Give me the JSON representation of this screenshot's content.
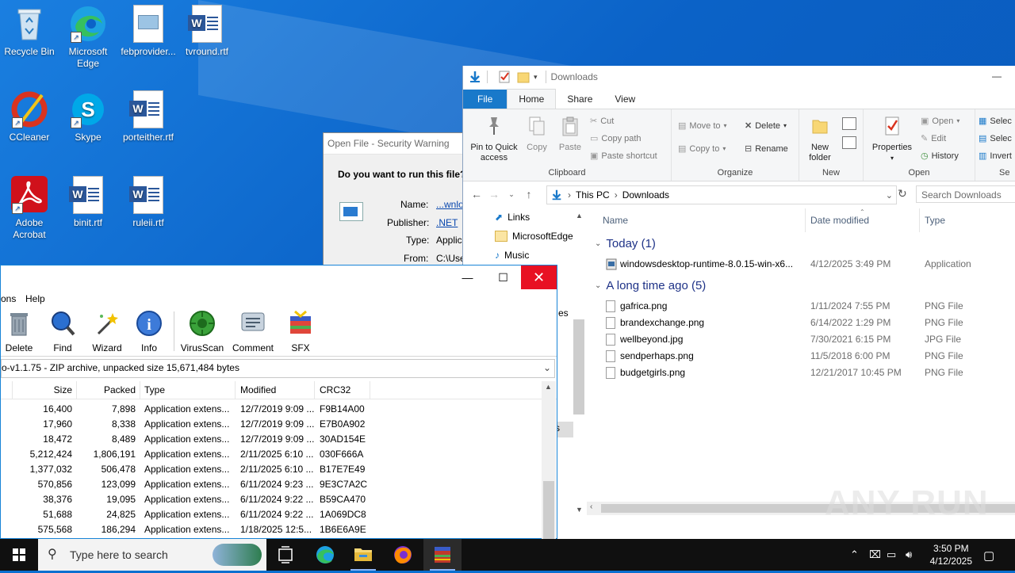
{
  "desktop": {
    "icons": [
      {
        "label": "Recycle Bin"
      },
      {
        "label": "Microsoft Edge"
      },
      {
        "label": "febprovider..."
      },
      {
        "label": "tvround.rtf"
      },
      {
        "label": "CCleaner"
      },
      {
        "label": "Skype"
      },
      {
        "label": "porteither.rtf"
      },
      {
        "label": "Adobe Acrobat"
      },
      {
        "label": "binit.rtf"
      },
      {
        "label": "ruleii.rtf"
      }
    ]
  },
  "security_dialog": {
    "title": "Open File - Security Warning",
    "question": "Do you want to run this file?",
    "name_label": "Name:",
    "name_value": "...wnlo",
    "publisher_label": "Publisher:",
    "publisher_value": ".NET",
    "type_label": "Type:",
    "type_value": "Applic",
    "from_label": "From:",
    "from_value": "C:\\Use"
  },
  "explorer": {
    "title": "Downloads",
    "tabs": [
      "File",
      "Home",
      "Share",
      "View"
    ],
    "ribbon": {
      "clipboard": {
        "pin": "Pin to Quick access",
        "copy": "Copy",
        "paste": "Paste",
        "cut": "Cut",
        "copy_path": "Copy path",
        "paste_shortcut": "Paste shortcut",
        "label": "Clipboard"
      },
      "organize": {
        "move_to": "Move to",
        "copy_to": "Copy to",
        "delete": "Delete",
        "rename": "Rename",
        "label": "Organize"
      },
      "new": {
        "new_folder": "New folder",
        "label": "New"
      },
      "open": {
        "properties": "Properties",
        "open": "Open",
        "edit": "Edit",
        "history": "History",
        "label": "Open"
      },
      "select": {
        "select_all": "Selec",
        "select_none": "Selec",
        "invert": "Invert",
        "label": "Se"
      }
    },
    "address": {
      "this_pc": "This PC",
      "downloads": "Downloads",
      "search_placeholder": "Search Downloads"
    },
    "nav": [
      "Links",
      "MicrosoftEdge",
      "Music"
    ],
    "columns": {
      "name": "Name",
      "date": "Date modified",
      "type": "Type"
    },
    "groups": [
      {
        "header": "Today (1)",
        "files": [
          {
            "name": "windowsdesktop-runtime-8.0.15-win-x6...",
            "date": "4/12/2025 3:49 PM",
            "type": "Application"
          }
        ]
      },
      {
        "header": "A long time ago (5)",
        "files": [
          {
            "name": "gafrica.png",
            "date": "1/11/2024 7:55 PM",
            "type": "PNG File"
          },
          {
            "name": "brandexchange.png",
            "date": "6/14/2022 1:29 PM",
            "type": "PNG File"
          },
          {
            "name": "wellbeyond.jpg",
            "date": "7/30/2021 6:15 PM",
            "type": "JPG File"
          },
          {
            "name": "sendperhaps.png",
            "date": "11/5/2018 6:00 PM",
            "type": "PNG File"
          },
          {
            "name": "budgetgirls.png",
            "date": "12/21/2017 10:45 PM",
            "type": "PNG File"
          }
        ]
      }
    ],
    "hidden_fragments": {
      "es": "es",
      "s": "s"
    }
  },
  "winrar": {
    "menu": [
      "ons",
      "Help"
    ],
    "toolbar": [
      "Delete",
      "Find",
      "Wizard",
      "Info",
      "VirusScan",
      "Comment",
      "SFX"
    ],
    "path": "o-v1.1.75 - ZIP archive, unpacked size 15,671,484 bytes",
    "columns": [
      "Size",
      "Packed",
      "Type",
      "Modified",
      "CRC32"
    ],
    "rows": [
      {
        "size": "16,400",
        "packed": "7,898",
        "type": "Application extens...",
        "modified": "12/7/2019 9:09 ...",
        "crc": "F9B14A00"
      },
      {
        "size": "17,960",
        "packed": "8,338",
        "type": "Application extens...",
        "modified": "12/7/2019 9:09 ...",
        "crc": "E7B0A902"
      },
      {
        "size": "18,472",
        "packed": "8,489",
        "type": "Application extens...",
        "modified": "12/7/2019 9:09 ...",
        "crc": "30AD154E"
      },
      {
        "size": "5,212,424",
        "packed": "1,806,191",
        "type": "Application extens...",
        "modified": "2/11/2025 6:10 ...",
        "crc": "030F666A"
      },
      {
        "size": "1,377,032",
        "packed": "506,478",
        "type": "Application extens...",
        "modified": "2/11/2025 6:10 ...",
        "crc": "B17E7E49"
      },
      {
        "size": "570,856",
        "packed": "123,099",
        "type": "Application extens...",
        "modified": "6/11/2024 9:23 ...",
        "crc": "9E3C7A2C"
      },
      {
        "size": "38,376",
        "packed": "19,095",
        "type": "Application extens...",
        "modified": "6/11/2024 9:22 ...",
        "crc": "B59CA470"
      },
      {
        "size": "51,688",
        "packed": "24,825",
        "type": "Application extens...",
        "modified": "6/11/2024 9:22 ...",
        "crc": "1A069DC8"
      },
      {
        "size": "575,568",
        "packed": "186,294",
        "type": "Application extens...",
        "modified": "1/18/2025 12:5...",
        "crc": "1B6E6A9E"
      }
    ]
  },
  "taskbar": {
    "search_placeholder": "Type here to search",
    "time": "3:50 PM",
    "date": "4/12/2025"
  },
  "watermark": "ANY RUN"
}
